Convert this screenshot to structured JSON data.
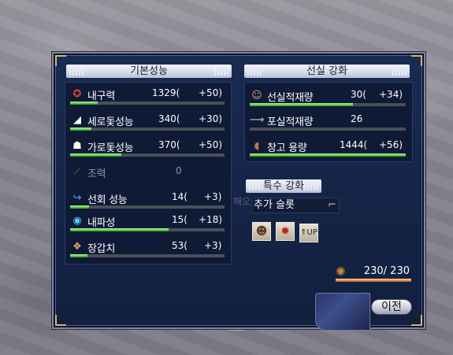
{
  "basic": {
    "title": "기본성능",
    "rows": [
      {
        "icon": "durability-icon",
        "label": "내구력",
        "value": "1329(",
        "bonus": "+50)",
        "fill": 0.18
      },
      {
        "icon": "vertical-sail-icon",
        "label": "세로돛성능",
        "value": "340(",
        "bonus": "+30)",
        "fill": 0.14
      },
      {
        "icon": "horizontal-sail-icon",
        "label": "가로돛성능",
        "value": "370(",
        "bonus": "+50)",
        "fill": 0.33
      },
      {
        "icon": "rowing-icon",
        "label": "조력",
        "value": "0",
        "bonus": "",
        "fill": 0.0
      },
      {
        "icon": "turning-icon",
        "label": "선회 성능",
        "value": "14(",
        "bonus": "+3)",
        "fill": 0.12
      },
      {
        "icon": "wave-icon",
        "label": "내파성",
        "value": "15(",
        "bonus": "+18)",
        "fill": 0.64
      },
      {
        "icon": "armor-icon",
        "label": "장갑치",
        "value": "53(",
        "bonus": "+3)",
        "fill": 0.11
      }
    ]
  },
  "cabin": {
    "title": "선실 강화",
    "rows": [
      {
        "icon": "sailor-icon",
        "label": "선실적재량",
        "value": "30(",
        "bonus": "+34)",
        "fill": 0.66
      },
      {
        "icon": "cannon-icon",
        "label": "포실적재량",
        "value": "26",
        "bonus": "",
        "fill": 0.0
      },
      {
        "icon": "barrel-icon",
        "label": "창고 용량",
        "value": "1444(",
        "bonus": "+56)",
        "fill": 1.0
      }
    ]
  },
  "special": {
    "title": "특수 강화",
    "slot_label": "추가 슬롯",
    "watermark": "해오",
    "items": [
      {
        "icon": "figure-icon"
      },
      {
        "icon": "bomb-icon"
      },
      {
        "icon": "upgrade-icon"
      }
    ]
  },
  "crew": {
    "icon": "crew-wheel-icon",
    "value": "230/ 230",
    "fill": 1.0
  },
  "buttons": {
    "prev_label": "이전"
  },
  "colors": {
    "panel_bg": "#142446",
    "bar_fill": "#5ed14a",
    "crew_fill": "#e58b4c",
    "header_bg": "#d8dceb"
  }
}
